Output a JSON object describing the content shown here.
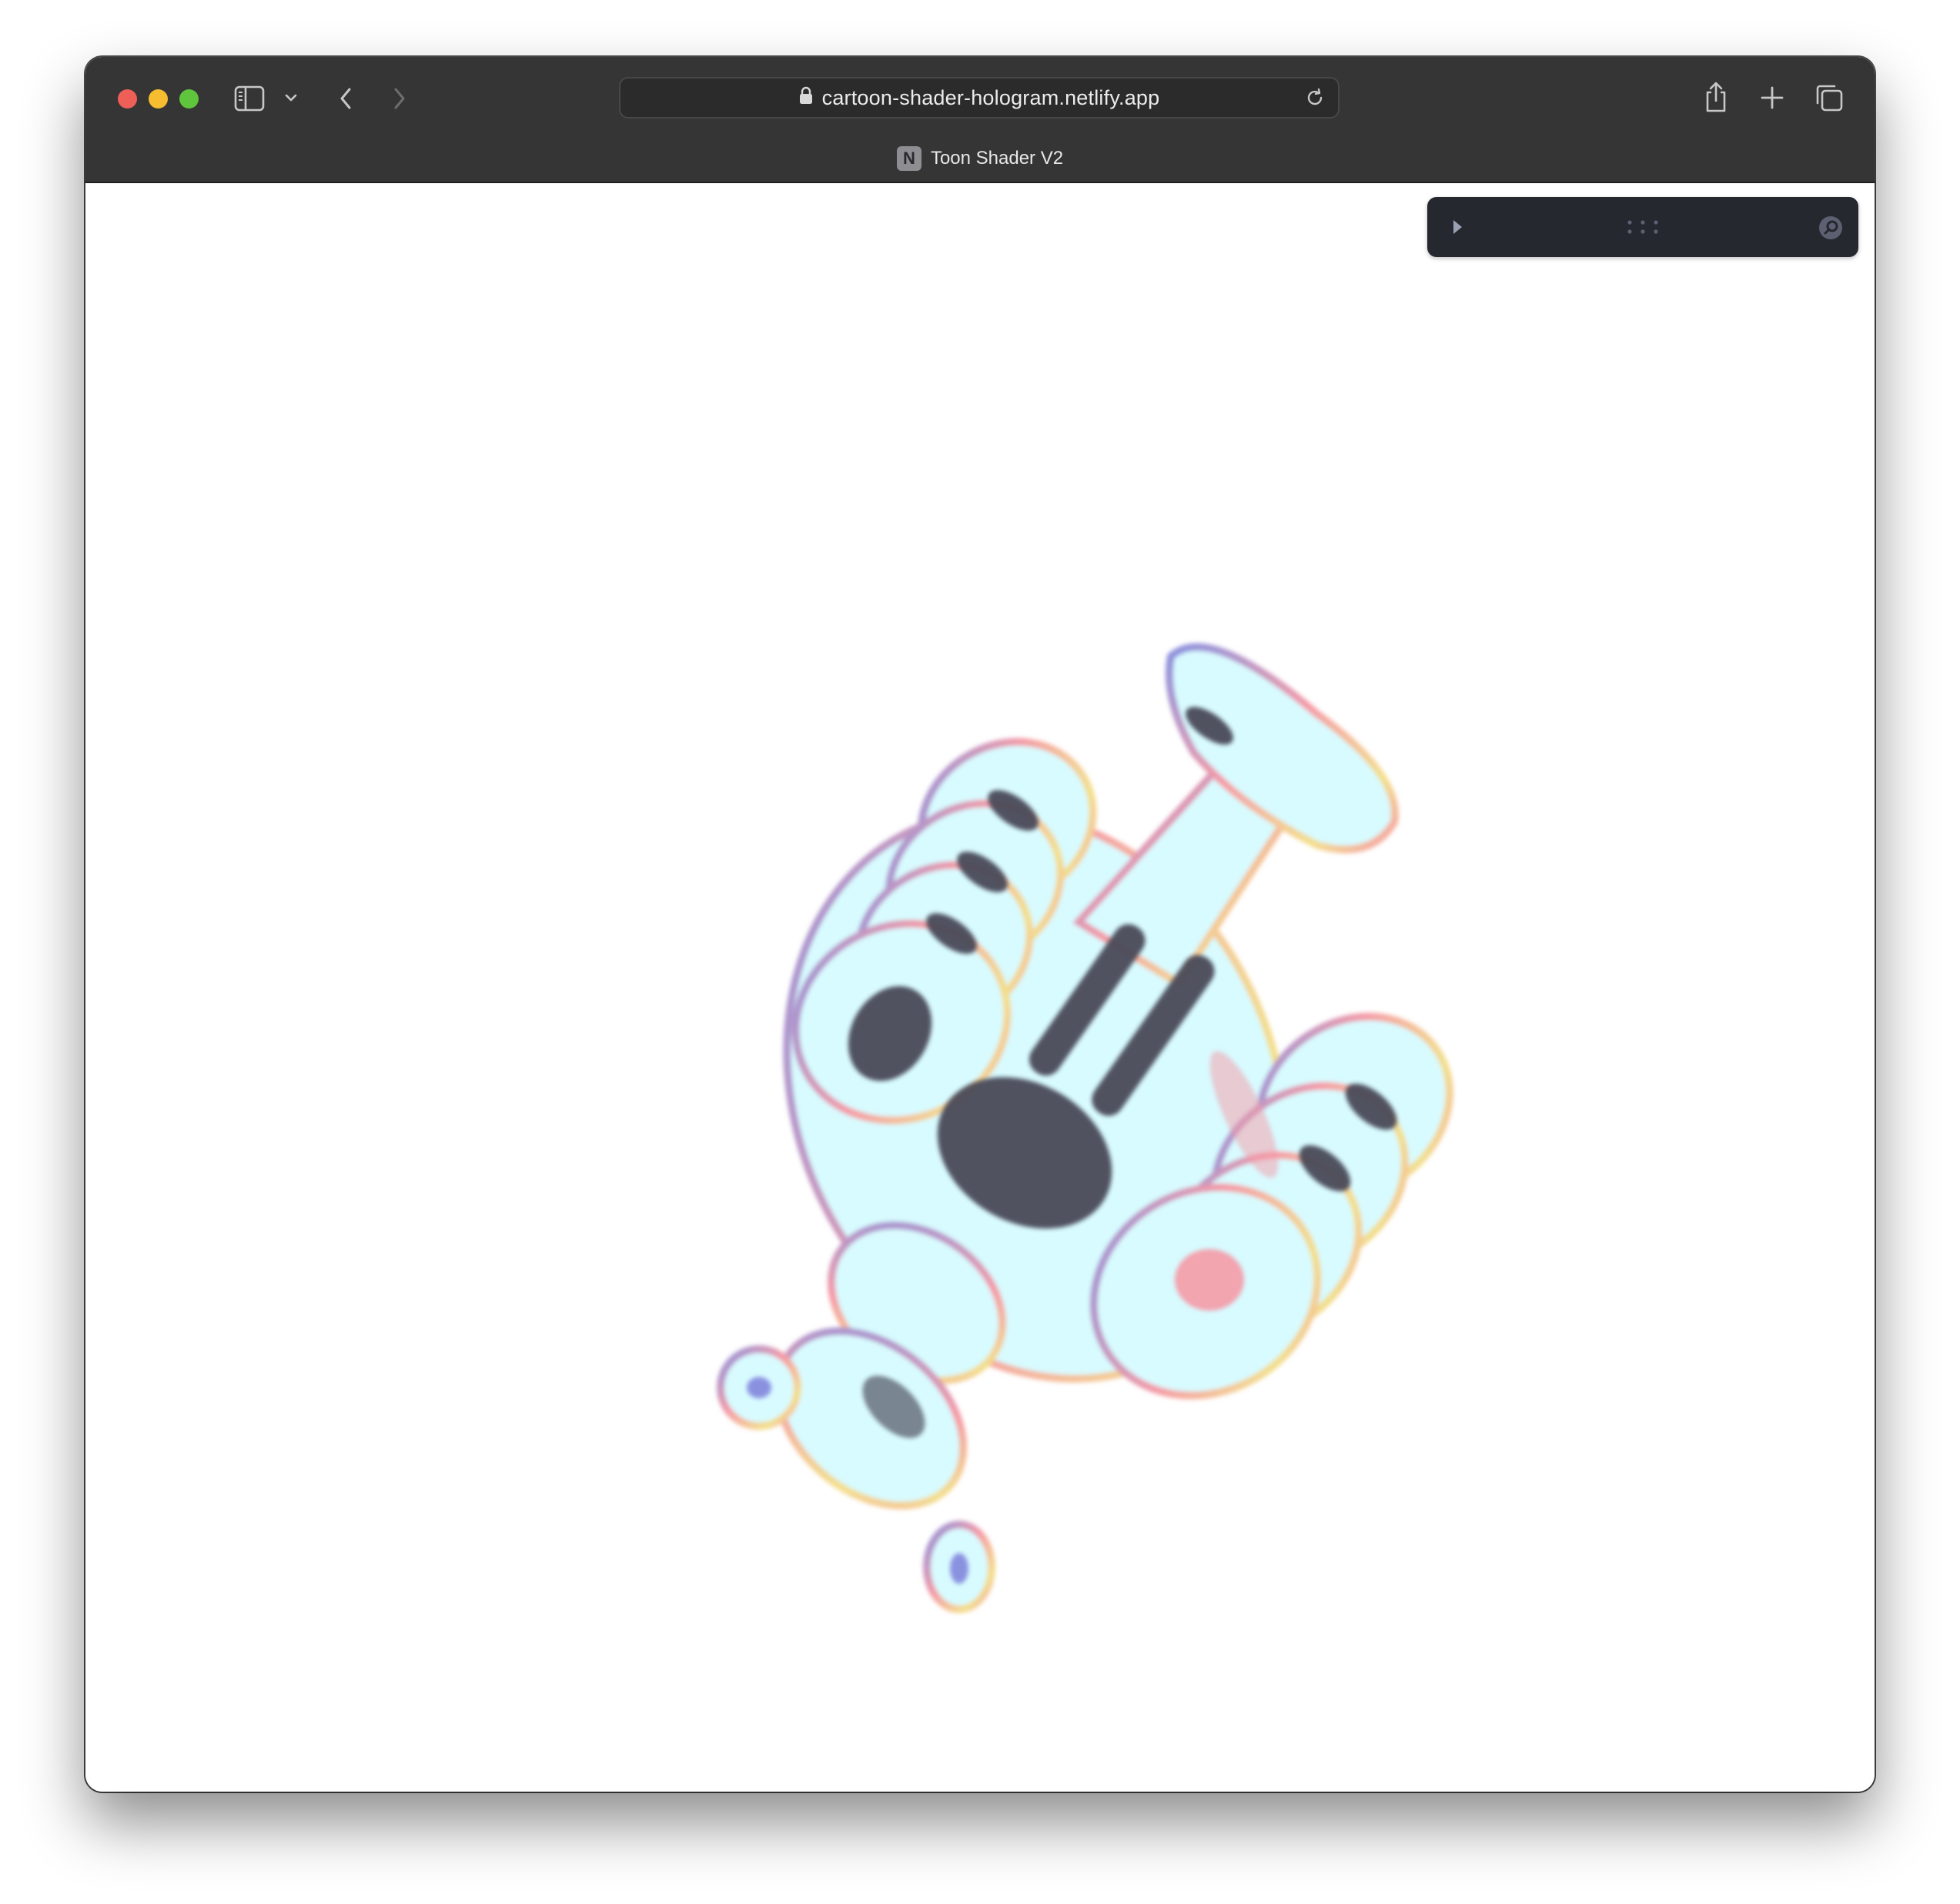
{
  "browser": {
    "url": "cartoon-shader-hologram.netlify.app",
    "tab_title": "Toon Shader V2",
    "tab_favicon_letter": "N",
    "icons": [
      "sidebar-icon",
      "chevron-down-icon",
      "back-icon",
      "forward-icon",
      "lock-icon",
      "reload-icon",
      "share-icon",
      "new-tab-icon",
      "tabs-overview-icon"
    ]
  },
  "gui": {
    "icons": [
      "play-icon",
      "drag-handle-icon",
      "search-icon"
    ],
    "panel_color": "#262830"
  },
  "scene": {
    "object": "hologram-toon-shaded-3d-model",
    "palette": [
      "#d8fbff",
      "#4a4858",
      "#f59aa6",
      "#8a92e0",
      "#f3e08c"
    ]
  }
}
